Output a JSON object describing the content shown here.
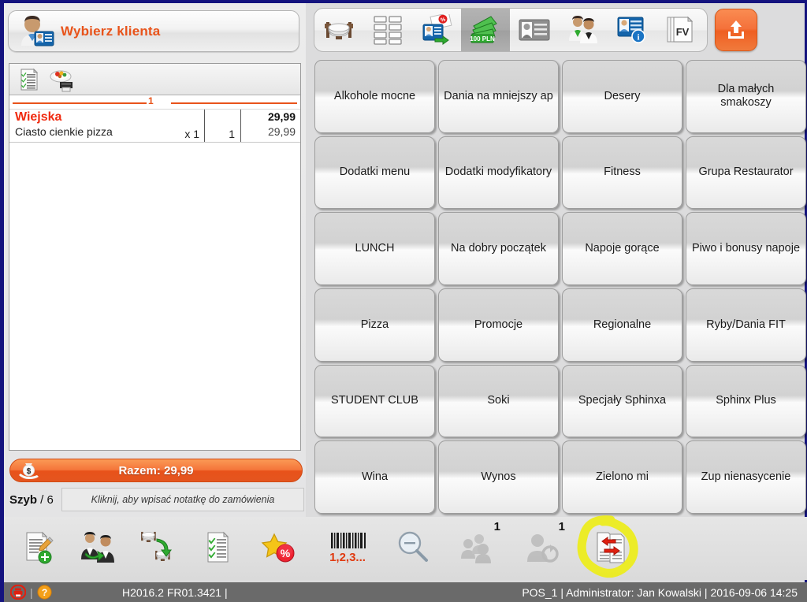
{
  "app": {
    "background": "#dcdcdd",
    "accent": "#e8531a",
    "border_color": "#14137e"
  },
  "left_panel": {
    "customer_bar": {
      "label": "Wybierz klienta",
      "icon": "customer-avatar-card-icon",
      "color": "#e8531a"
    },
    "order_tools": [
      {
        "icon": "checklist-document-icon",
        "name": "order-list-icon"
      },
      {
        "icon": "food-plate-printer-icon",
        "name": "print-food-icon"
      }
    ],
    "separator_number": "1",
    "order_items": [
      {
        "name": "Wiejska",
        "description": "Ciasto cienkie pizza",
        "multiplier": "x 1",
        "quantity": "1",
        "unit_price": "29,99",
        "line_total": "29,99",
        "name_color": "#f02b10"
      }
    ],
    "total": {
      "label": "Razem: 29,99",
      "icon": "money-bag-hand-icon"
    },
    "note": {
      "tag_bold": "Szyb",
      "tag_rest": " / 6",
      "placeholder": "Kliknij, aby wpisać notatkę do zamówienia",
      "value": ""
    }
  },
  "top_toolbar": {
    "buttons": [
      {
        "icon": "table-chairs-icon",
        "name": "tables-view-button",
        "selected": false
      },
      {
        "icon": "grid-tables-icon",
        "name": "table-grid-button",
        "selected": false
      },
      {
        "icon": "card-arrow-right-icon",
        "name": "assign-customer-button",
        "selected": false
      },
      {
        "icon": "banknotes-100pln-icon",
        "name": "cash-payment-button",
        "selected": true,
        "text": "100 PLN"
      },
      {
        "icon": "id-card-grey-icon",
        "name": "customer-card-button",
        "selected": false
      },
      {
        "icon": "two-people-icon",
        "name": "staff-button",
        "selected": false
      },
      {
        "icon": "card-info-icon",
        "name": "customer-info-button",
        "selected": false
      },
      {
        "icon": "invoice-fv-icon",
        "name": "invoice-button",
        "selected": false,
        "text": "FV"
      },
      {
        "icon": "gears-icon",
        "name": "settings-button",
        "selected": false
      }
    ],
    "export_button": {
      "icon": "upload-export-icon",
      "name": "export-button"
    }
  },
  "categories": [
    "Alkohole mocne",
    "Dania na mniejszy ap",
    "Desery",
    "Dla małych smakoszy",
    "Dodatki menu",
    "Dodatki modyfikatory",
    "Fitness",
    "Grupa Restaurator",
    "LUNCH",
    "Na dobry początek",
    "Napoje gorące",
    "Piwo i bonusy napoje",
    "Pizza",
    "Promocje",
    "Regionalne",
    "Ryby/Dania FIT",
    "STUDENT CLUB",
    "Soki",
    "Specjały Sphinxa",
    "Sphinx Plus",
    "Wina",
    "Wynos",
    "Zielono mi",
    "Zup nienasycenie"
  ],
  "bottom_toolbar": {
    "items": [
      {
        "icon": "new-order-document-icon",
        "name": "new-order-button",
        "badge": "",
        "disabled": false
      },
      {
        "icon": "transfer-people-icon",
        "name": "transfer-waiter-button",
        "badge": "",
        "disabled": false
      },
      {
        "icon": "move-table-icon",
        "name": "move-table-button",
        "badge": "",
        "disabled": false
      },
      {
        "icon": "checklist-document-icon",
        "name": "order-list-button",
        "badge": "",
        "disabled": false
      },
      {
        "icon": "star-percent-icon",
        "name": "discount-button",
        "badge": "",
        "disabled": false
      },
      {
        "icon": "barcode-icon",
        "name": "barcode-button",
        "badge": "",
        "disabled": false,
        "text": "1,2,3..."
      },
      {
        "icon": "magnifier-icon",
        "name": "search-button",
        "badge": "",
        "disabled": false
      },
      {
        "icon": "group-people-icon",
        "name": "group-orders-button",
        "badge": "1",
        "disabled": true
      },
      {
        "icon": "person-refresh-icon",
        "name": "switch-user-button",
        "badge": "1",
        "disabled": true
      },
      {
        "icon": "document-swap-arrows-icon",
        "name": "split-bill-button",
        "badge": "",
        "disabled": false,
        "highlighted": true
      }
    ],
    "highlight_color": "#eded18"
  },
  "status_bar": {
    "print_icon": "printer-red-icon",
    "help_icon": "help-question-icon",
    "separator": "|",
    "version": "H2016.2 FR01.3421 |",
    "right": "POS_1 | Administrator: Jan Kowalski | 2016-09-06 14:25"
  }
}
